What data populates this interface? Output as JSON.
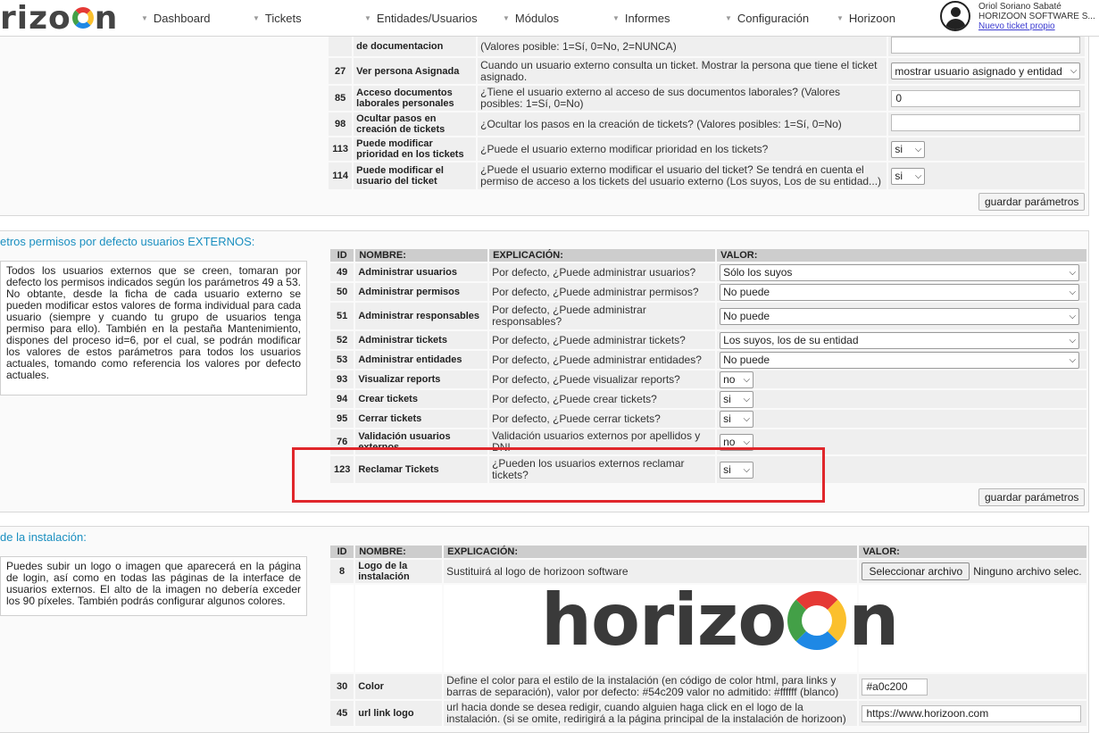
{
  "topbar": {
    "logo_text": "rizo",
    "logo_tail": "n",
    "nav": [
      "Dashboard",
      "Tickets",
      "Entidades/Usuarios",
      "Módulos",
      "Informes",
      "Configuración",
      "Horizoon"
    ],
    "user": {
      "name": "Oriol Soriano Sabaté",
      "company": "HORIZOON SOFTWARE S...",
      "link": "Nuevo ticket propio"
    }
  },
  "section1": {
    "rows": [
      {
        "id": "",
        "name": "de documentacion",
        "explanation": "(Valores posible: 1=Sí, 0=No, 2=NUNCA)",
        "value_type": "text",
        "value": ""
      },
      {
        "id": "27",
        "name": "Ver persona Asignada",
        "explanation": "Cuando un usuario externo consulta un ticket. Mostrar la persona que tiene el ticket asignado.",
        "value_type": "select_wide",
        "value": "mostrar usuario asignado y entidad"
      },
      {
        "id": "85",
        "name": "Acceso documentos laborales personales",
        "explanation": "¿Tiene el usuario externo al acceso de sus documentos laborales? (Valores posibles: 1=Sí, 0=No)",
        "value_type": "text",
        "value": "0"
      },
      {
        "id": "98",
        "name": "Ocultar pasos en creación de tickets",
        "explanation": "¿Ocultar los pasos en la creación de tickets? (Valores posibles: 1=Sí, 0=No)",
        "value_type": "text",
        "value": ""
      },
      {
        "id": "113",
        "name": "Puede modificar prioridad en los tickets",
        "explanation": "¿Puede el usuario externo modificar prioridad en los tickets?",
        "value_type": "select_small",
        "value": "si"
      },
      {
        "id": "114",
        "name": "Puede modificar el usuario del ticket",
        "explanation": "¿Puede el usuario externo modificar el usuario del ticket? Se tendrá en cuenta el permiso de acceso a los tickets del usuario externo (Los suyos, Los de su entidad...)",
        "value_type": "select_small",
        "value": "si"
      }
    ],
    "save_label": "guardar parámetros"
  },
  "section2": {
    "title": "etros permisos por defecto usuarios EXTERNOS:",
    "info": "Todos los usuarios externos que se creen, tomaran por defecto los permisos indicados según los parámetros 49 a 53. No obtante, desde la ficha de cada usuario externo se pueden modificar estos valores de forma individual para cada usuario (siempre y cuando tu grupo de usuarios tenga permiso para ello). También en la pestaña Mantenimiento, dispones del proceso id=6, por el cual, se podrán modificar los valores de estos parámetros para todos los usuarios actuales, tomando como referencia los valores por defecto actuales.",
    "headers": {
      "id": "ID",
      "name": "NOMBRE:",
      "explanation": "EXPLICACIÓN:",
      "value": "VALOR:"
    },
    "rows": [
      {
        "id": "49",
        "name": "Administrar usuarios",
        "explanation": "Por defecto, ¿Puede administrar usuarios?",
        "value_type": "select_wide",
        "value": "Sólo los suyos"
      },
      {
        "id": "50",
        "name": "Administrar permisos",
        "explanation": "Por defecto, ¿Puede administrar permisos?",
        "value_type": "select_wide",
        "value": "No puede"
      },
      {
        "id": "51",
        "name": "Administrar responsables",
        "explanation": "Por defecto, ¿Puede administrar responsables?",
        "value_type": "select_wide",
        "value": "No puede"
      },
      {
        "id": "52",
        "name": "Administrar tickets",
        "explanation": "Por defecto, ¿Puede administrar tickets?",
        "value_type": "select_wide",
        "value": "Los suyos, los de su entidad"
      },
      {
        "id": "53",
        "name": "Administrar entidades",
        "explanation": "Por defecto, ¿Puede administrar entidades?",
        "value_type": "select_wide",
        "value": "No puede"
      },
      {
        "id": "93",
        "name": "Visualizar reports",
        "explanation": "Por defecto, ¿Puede visualizar reports?",
        "value_type": "select_small",
        "value": "no"
      },
      {
        "id": "94",
        "name": "Crear tickets",
        "explanation": "Por defecto, ¿Puede crear tickets?",
        "value_type": "select_small",
        "value": "si"
      },
      {
        "id": "95",
        "name": "Cerrar tickets",
        "explanation": "Por defecto, ¿Puede cerrar tickets?",
        "value_type": "select_small",
        "value": "si"
      },
      {
        "id": "76",
        "name": "Validación usuarios externos",
        "explanation": "Validación usuarios externos por apellidos y DNI",
        "value_type": "select_small",
        "value": "no"
      },
      {
        "id": "123",
        "name": "Reclamar Tickets",
        "explanation": "¿Pueden los usuarios externos reclamar tickets?",
        "value_type": "select_small",
        "value": "si"
      }
    ],
    "save_label": "guardar parámetros"
  },
  "section3": {
    "title": "de la instalación:",
    "info": "Puedes subir un logo o imagen que aparecerá en la página de login, así como en todas las páginas de la interface de usuarios externos. El alto de la imagen no debería exceder los 90 píxeles. También podrás configurar algunos colores.",
    "headers": {
      "id": "ID",
      "name": "NOMBRE:",
      "explanation": "EXPLICACIÓN:",
      "value": "VALOR:"
    },
    "rows": [
      {
        "id": "8",
        "name": "Logo de la instalación",
        "explanation": "Sustituirá al logo de horizoon software",
        "file_button": "Seleccionar archivo",
        "file_status": "Ninguno archivo selec."
      },
      {
        "id": "30",
        "name": "Color",
        "explanation": "Define el color para el estilo de la instalación (en código de color html, para links y barras de separación), valor por defecto: #54c209 valor no admitido: #ffffff (blanco)",
        "value": "#a0c200"
      },
      {
        "id": "45",
        "name": "url link logo",
        "explanation": "url hacia donde se desea redigir, cuando alguien haga click en el logo de la instalación. (si se omite, redirigirá a la página principal de la instalación de horizoon)",
        "value": "https://www.horizoon.com"
      }
    ],
    "brand_text": "horizo",
    "brand_tail": "n"
  }
}
